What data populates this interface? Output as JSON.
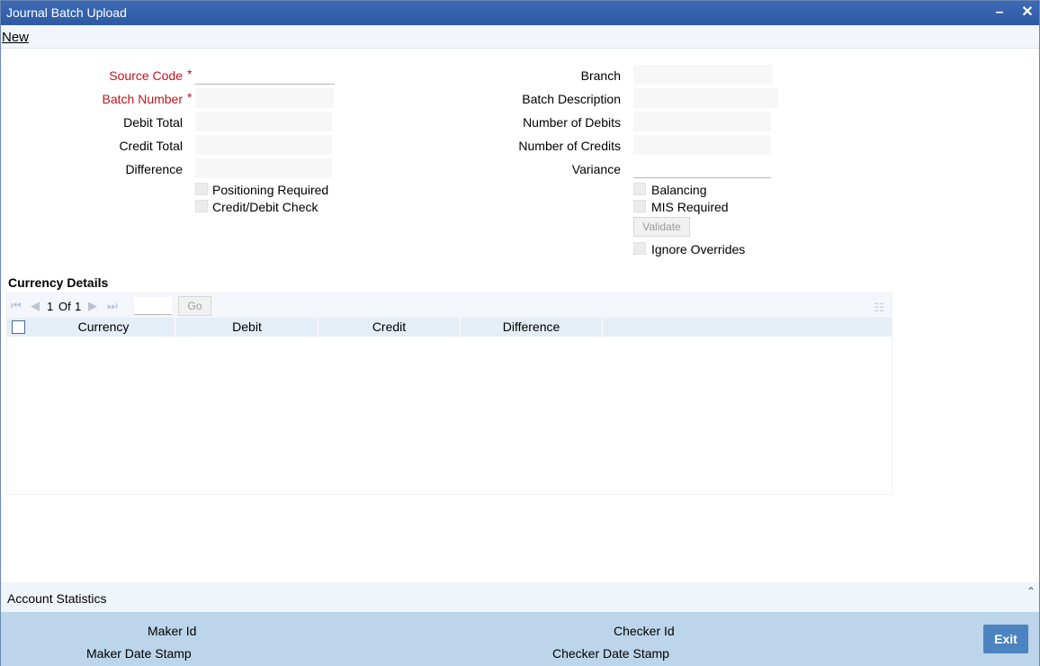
{
  "window": {
    "title": "Journal Batch Upload"
  },
  "menu": {
    "new_label": "New"
  },
  "form": {
    "source_code_label": "Source Code",
    "batch_number_label": "Batch Number",
    "debit_total_label": "Debit Total",
    "credit_total_label": "Credit Total",
    "difference_label": "Difference",
    "positioning_required_label": "Positioning Required",
    "credit_debit_check_label": "Credit/Debit Check",
    "branch_label": "Branch",
    "batch_description_label": "Batch Description",
    "number_of_debits_label": "Number of Debits",
    "number_of_credits_label": "Number of Credits",
    "variance_label": "Variance",
    "balancing_label": "Balancing",
    "mis_required_label": "MIS Required",
    "validate_label": "Validate",
    "ignore_overrides_label": "Ignore Overrides",
    "required_marker": "*"
  },
  "currency_details": {
    "title": "Currency Details",
    "pager": {
      "current": "1",
      "of_label": "Of",
      "total": "1",
      "go_label": "Go"
    },
    "columns": [
      "Currency",
      "Debit",
      "Credit",
      "Difference"
    ]
  },
  "footer": {
    "account_statistics_label": "Account Statistics",
    "maker_id_label": "Maker Id",
    "maker_date_stamp_label": "Maker Date Stamp",
    "checker_id_label": "Checker Id",
    "checker_date_stamp_label": "Checker Date Stamp",
    "exit_label": "Exit"
  },
  "colors": {
    "titlebar": "#2d5aa3",
    "required": "#c3141b",
    "footer": "#bcd5ea",
    "exit_button": "#4b84c0"
  },
  "icons": [
    "minimize-icon",
    "close-icon",
    "first-page-icon",
    "prev-page-icon",
    "next-page-icon",
    "last-page-icon",
    "column-list-icon",
    "collapse-up-icon"
  ]
}
